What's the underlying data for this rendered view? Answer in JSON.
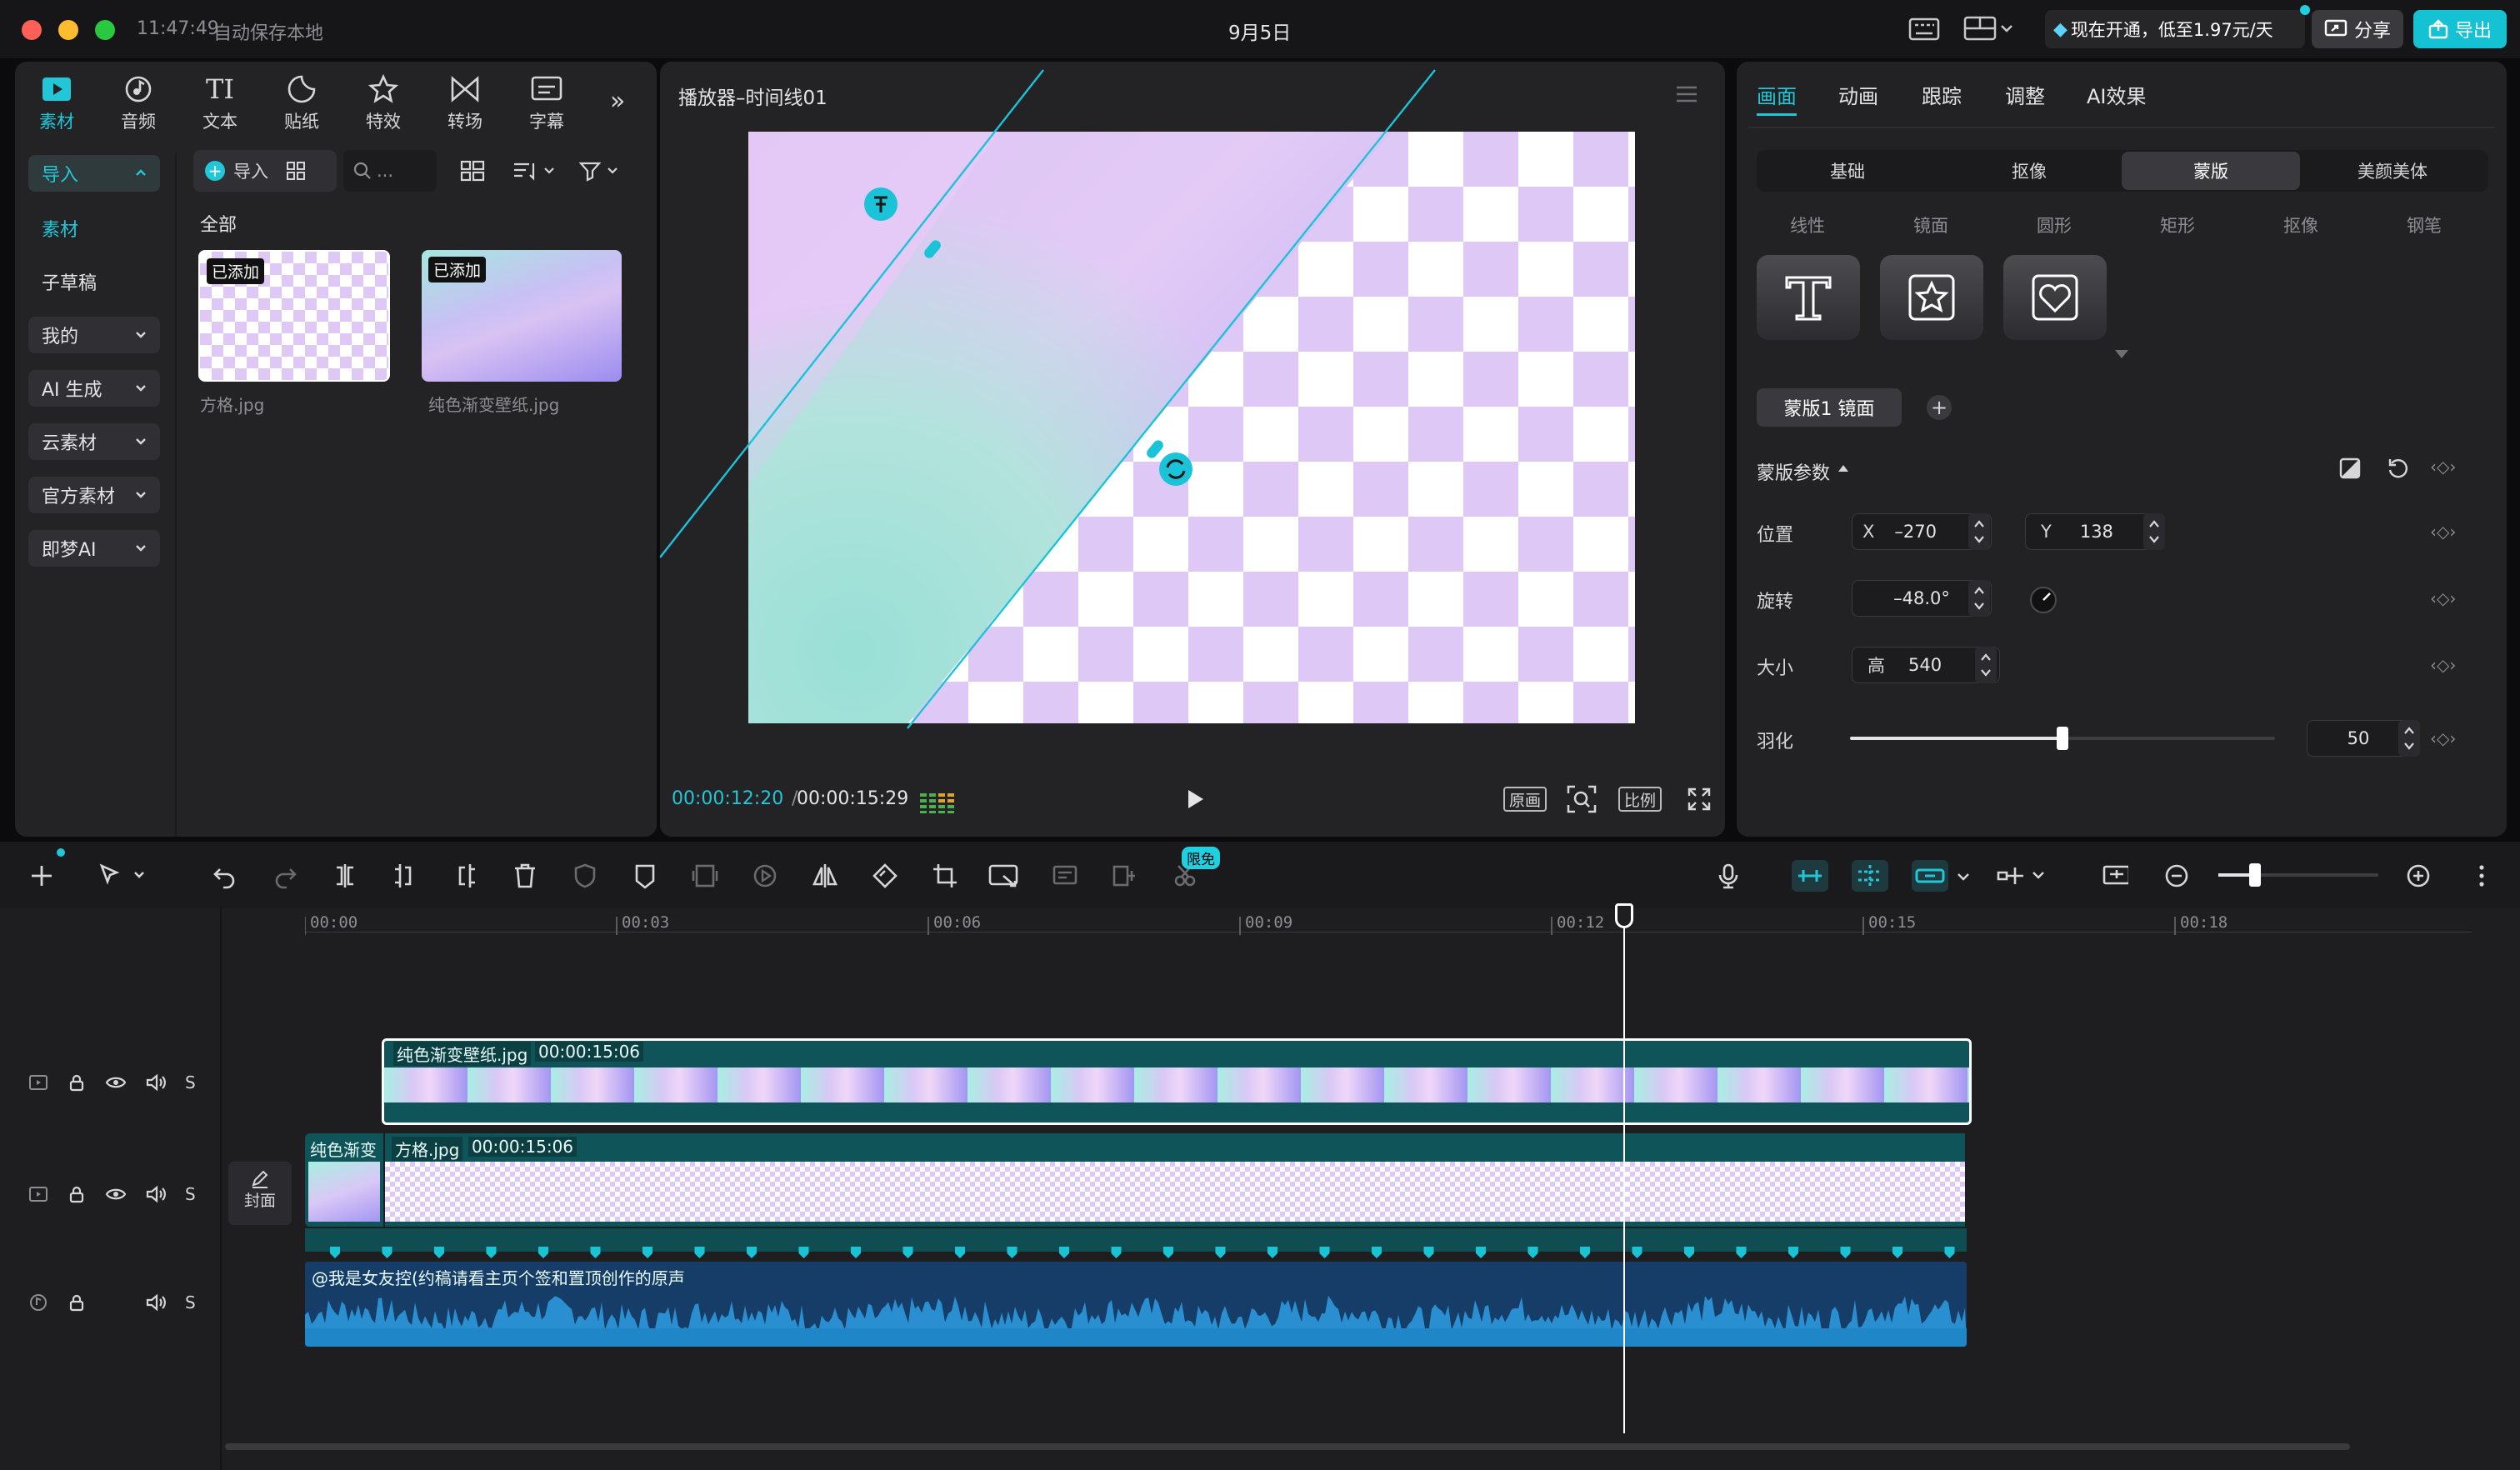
{
  "titlebar": {
    "time": "11:47:49",
    "autosave": "自动保存本地",
    "project_title": "9月5日",
    "promo": "现在开通，低至1.97元/天",
    "share": "分享",
    "export": "导出"
  },
  "left_tabs": [
    {
      "label": "素材",
      "icon": "media-icon"
    },
    {
      "label": "音频",
      "icon": "audio-icon"
    },
    {
      "label": "文本",
      "icon": "text-icon"
    },
    {
      "label": "贴纸",
      "icon": "sticker-icon"
    },
    {
      "label": "特效",
      "icon": "effects-icon"
    },
    {
      "label": "转场",
      "icon": "transition-icon"
    },
    {
      "label": "字幕",
      "icon": "subtitle-icon"
    }
  ],
  "sidebar": {
    "import": "导入",
    "items": [
      "素材",
      "子草稿",
      "我的",
      "AI 生成",
      "云素材",
      "官方素材",
      "即梦AI"
    ]
  },
  "media": {
    "import_btn": "导入",
    "search_placeholder": "...",
    "section": "全部",
    "items": [
      {
        "badge": "已添加",
        "name": "方格.jpg"
      },
      {
        "badge": "已添加",
        "name": "纯色渐变壁纸.jpg"
      }
    ]
  },
  "player": {
    "title": "播放器–时间线01",
    "current": "00:00:12:20",
    "total": "00:00:15:29",
    "btn_original": "原画",
    "btn_ratio": "比例"
  },
  "inspector": {
    "tabs": [
      "画面",
      "动画",
      "跟踪",
      "调整",
      "AI效果"
    ],
    "segments": [
      "基础",
      "抠像",
      "蒙版",
      "美颜美体"
    ],
    "mask_types": [
      "线性",
      "镜面",
      "圆形",
      "矩形",
      "抠像",
      "钢笔"
    ],
    "mask_chip": "蒙版1 镜面",
    "params_title": "蒙版参数",
    "position_label": "位置",
    "x_label": "X",
    "x_value": "–270",
    "y_label": "Y",
    "y_value": "138",
    "rotation_label": "旋转",
    "rotation_value": "–48.0°",
    "size_label": "大小",
    "height_label": "高",
    "height_value": "540",
    "feather_label": "羽化",
    "feather_value": "50",
    "feather_level": 0.5
  },
  "toolbar": {
    "badge": "限免"
  },
  "timeline": {
    "ruler": [
      "00:00",
      "00:03",
      "00:06",
      "00:09",
      "00:12",
      "00:15",
      "00:18"
    ],
    "track1_clip": {
      "name": "纯色渐变壁纸.jpg",
      "duration": "00:00:15:06"
    },
    "track2_clips": {
      "first": "纯色渐变",
      "name": "方格.jpg",
      "duration": "00:00:15:06"
    },
    "cover": "封面",
    "audio_clip": "@我是女友控(约稿请看主页个签和置顶创作的原声",
    "solo": "S"
  }
}
